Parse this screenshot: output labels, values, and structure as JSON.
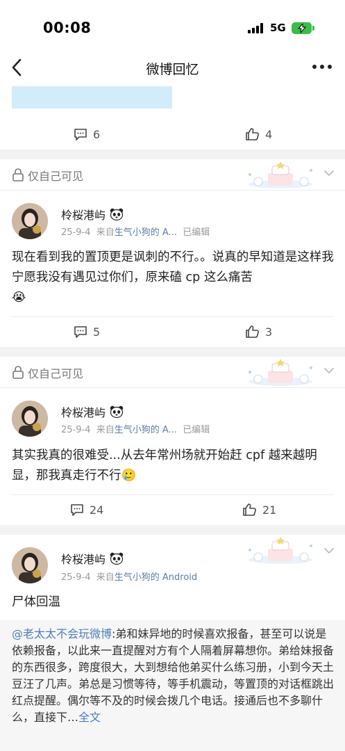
{
  "status_bar": {
    "time": "00:08",
    "network": "5G"
  },
  "nav": {
    "title": "微博回忆"
  },
  "top_post": {
    "comments": "6",
    "likes": "4"
  },
  "posts": [
    {
      "private_label": "仅自己可见",
      "username": "柃桜港屿",
      "date": "25-9-4",
      "source_prefix": "来自",
      "source": "生气小狗的 A...",
      "edited": "已编辑",
      "text": "现在看到我的置顶更是讽刺的不行。。说真的早知道是这样我宁愿我没有遇见过你们，原来磕 cp 这么痛苦",
      "emoji": "😭",
      "comments": "5",
      "likes": "3"
    },
    {
      "private_label": "仅自己可见",
      "username": "柃桜港屿",
      "date": "25-9-4",
      "source_prefix": "来自",
      "source": "生气小狗的 A...",
      "edited": "已编辑",
      "text": "其实我真的很难受...从去年常州场就开始赶 cpf 越来越明显，那我真走行不行",
      "emoji": "🥲",
      "comments": "24",
      "likes": "21"
    },
    {
      "username": "柃桜港屿",
      "date": "25-9-4",
      "source_prefix": "来自",
      "source": "生气小狗的 Android",
      "text": "尸体回温"
    }
  ],
  "repost": {
    "mention": "@老太太不会玩微博",
    "text": ":弟和妹异地的时候喜欢报备，甚至可以说是依赖报备，以此来一直提醒对方有个人隔着屏幕想你。弟给妹报备的东西很多，跨度很大，大到想给他弟买什么练习册，小到今天土豆汪了几声。弟总是习惯等待，等手机震动，等置顶的对话框跳出红点提醒。偶尔等不及的时候会拨几个电话。接通后也不多聊什么，直接下…",
    "fulltext": "全文"
  },
  "colors": {
    "accent_link": "#4f7cbb",
    "gap": "#f2f2f2",
    "battery": "#3bbd4a"
  }
}
